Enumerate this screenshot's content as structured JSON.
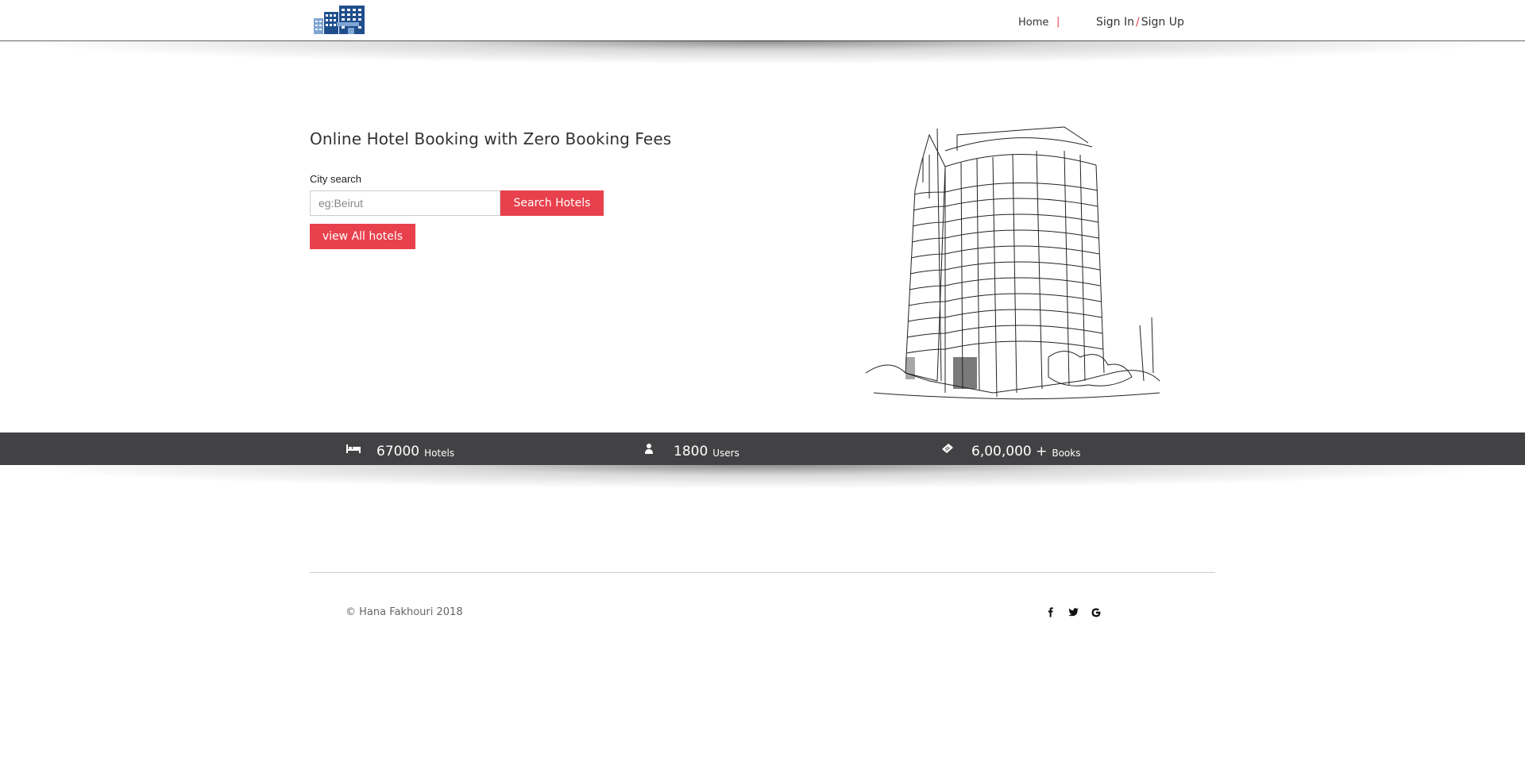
{
  "nav": {
    "home": "Home",
    "separator": "|",
    "sign_in": "Sign In",
    "slash": "/",
    "sign_up": "Sign Up"
  },
  "hero": {
    "title": "Online Hotel Booking with Zero Booking Fees",
    "search_label": "City search",
    "search_placeholder": "eg:Beirut",
    "search_button": "Search Hotels",
    "view_all_button": "view All hotels"
  },
  "stats": [
    {
      "icon": "bed-icon",
      "value": "67000",
      "label": "Hotels"
    },
    {
      "icon": "user-icon",
      "value": "1800",
      "label": "Users"
    },
    {
      "icon": "ticket-icon",
      "value": "6,00,000 +",
      "label": "Books"
    }
  ],
  "footer": {
    "copyright": "© Hana Fakhouri 2018",
    "social": [
      "facebook-icon",
      "twitter-icon",
      "google-icon"
    ]
  },
  "colors": {
    "accent": "#e8414d",
    "stats_band": "#424244",
    "logo_blue": "#1f4e8c"
  }
}
